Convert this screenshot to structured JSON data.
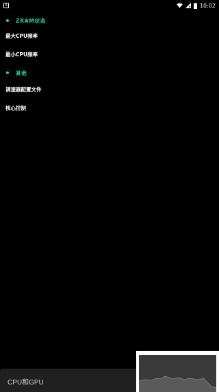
{
  "status_bar": {
    "notification_icon": "A",
    "time": "10:02",
    "icons": [
      "wifi-icon",
      "signal-icon",
      "battery-icon"
    ]
  },
  "sections": [
    {
      "title": "ZRAM状态",
      "items": [
        "最大CPU频率",
        "最小CPU频率"
      ]
    },
    {
      "title": "其他",
      "items": [
        "调速器配置文件",
        "核心控制"
      ]
    }
  ],
  "bottom_bar": {
    "label": "CPU和GPU"
  },
  "colors": {
    "accent": "#1ed9a4",
    "background": "#000000",
    "bottom_bar": "#202020",
    "overlay_frame": "#ffffff",
    "overlay_fill": "#3a3a3a"
  }
}
